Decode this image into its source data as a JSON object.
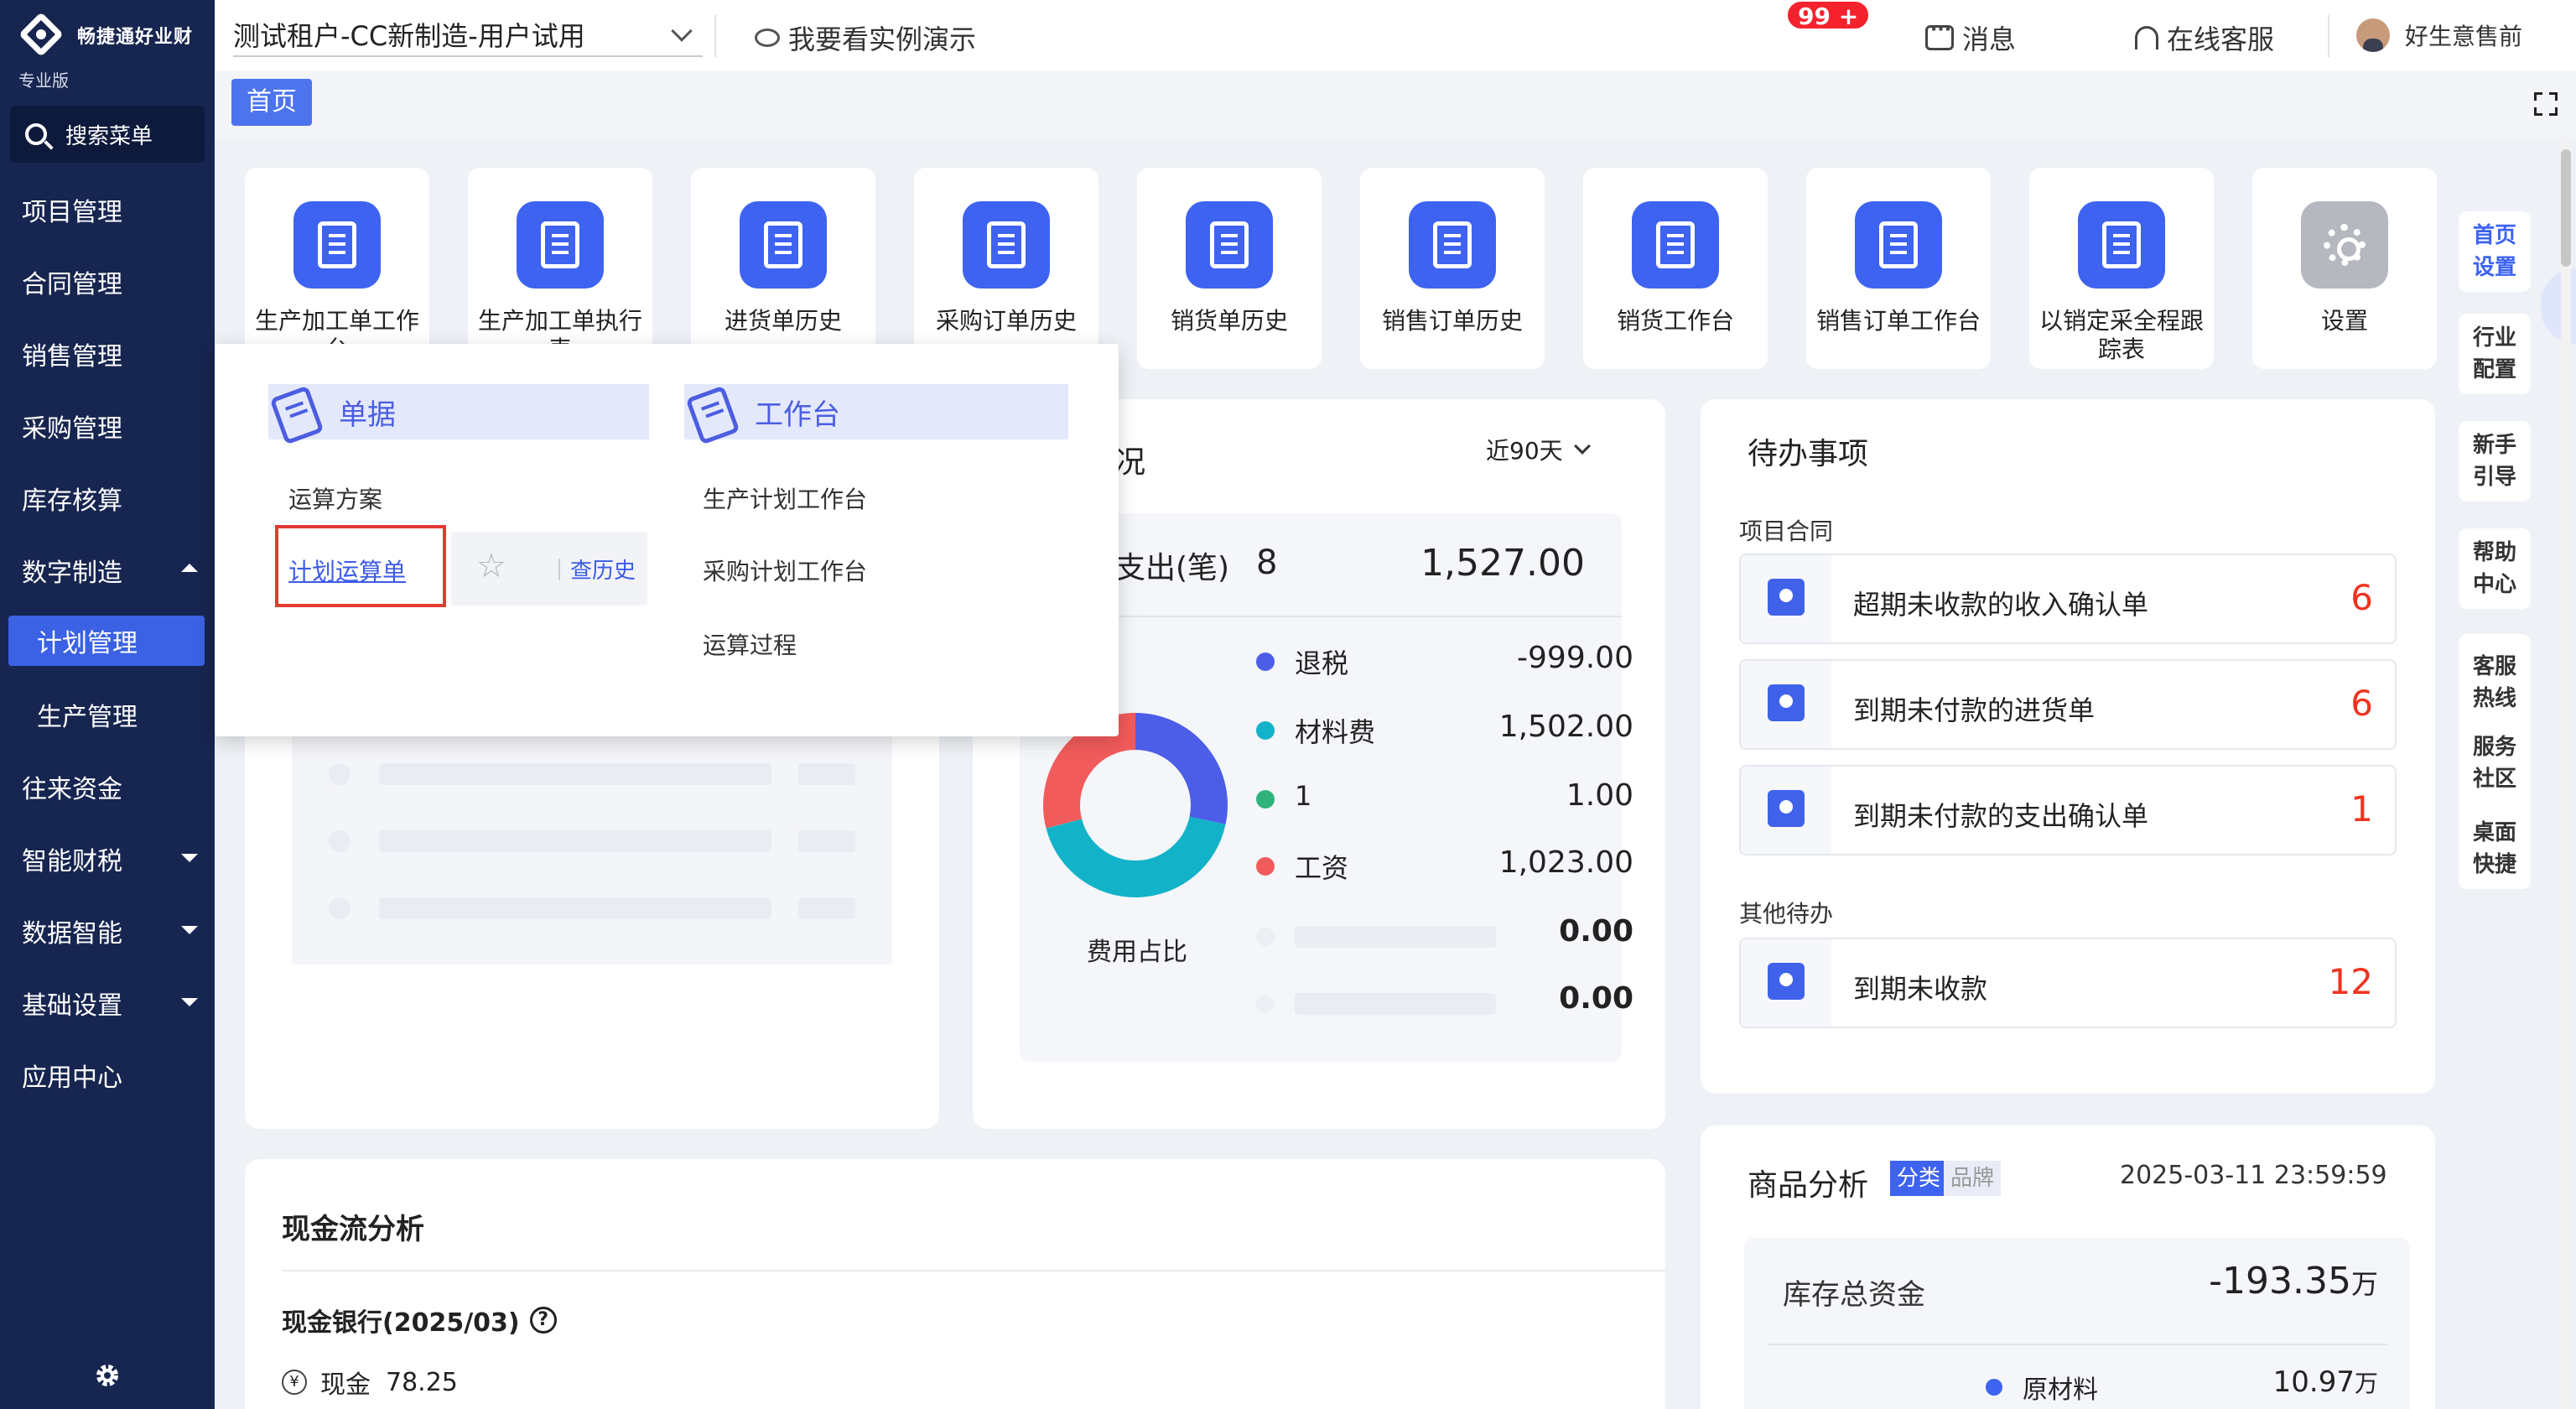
{
  "sidebar": {
    "logo_text": "畅捷通好业财",
    "edition": "专业版",
    "search_label": "搜索菜单",
    "items": [
      {
        "label": "项目管理"
      },
      {
        "label": "合同管理"
      },
      {
        "label": "销售管理"
      },
      {
        "label": "采购管理"
      },
      {
        "label": "库存核算"
      },
      {
        "label": "数字制造"
      },
      {
        "label": "计划管理"
      },
      {
        "label": "生产管理"
      },
      {
        "label": "往来资金"
      },
      {
        "label": "智能财税"
      },
      {
        "label": "数据智能"
      },
      {
        "label": "基础设置"
      },
      {
        "label": "应用中心"
      }
    ]
  },
  "header": {
    "tenant": "测试租户-CC新制造-用户试用",
    "demo": "我要看实例演示",
    "messages": "消息",
    "badge": "99 +",
    "service": "在线客服",
    "user": "好生意售前"
  },
  "tabs": {
    "home": "首页"
  },
  "shortcuts": [
    {
      "label": "生产加工单工作台"
    },
    {
      "label": "生产加工单执行表"
    },
    {
      "label": "进货单历史"
    },
    {
      "label": "采购订单历史"
    },
    {
      "label": "销货单历史"
    },
    {
      "label": "销售订单历史"
    },
    {
      "label": "销货工作台"
    },
    {
      "label": "销售订单工作台"
    },
    {
      "label": "以销定采全程跟踪表"
    },
    {
      "label": "设置"
    }
  ],
  "popup": {
    "col1_title": "单据",
    "col2_title": "工作台",
    "col1_items": [
      "运算方案",
      "计划运算单"
    ],
    "history": "查历史",
    "col2_items": [
      "生产计划工作台",
      "采购计划工作台",
      "运算过程"
    ]
  },
  "expense": {
    "title_fragment": "况",
    "range": "近90天",
    "summary_label": "支出(笔)",
    "summary_count": "8",
    "summary_total": "1,527.00",
    "donut_label": "费用占比",
    "legend": [
      {
        "name": "退税",
        "value": "-999.00",
        "color": "#4c5ee8"
      },
      {
        "name": "材料费",
        "value": "1,502.00",
        "color": "#12b3c8"
      },
      {
        "name": "1",
        "value": "1.00",
        "color": "#2fb37a"
      },
      {
        "name": "工资",
        "value": "1,023.00",
        "color": "#f25b5b"
      },
      {
        "name": "",
        "value": "0.00",
        "color": "#e9ebf2"
      },
      {
        "name": "",
        "value": "0.00",
        "color": "#e9ebf2"
      }
    ]
  },
  "chart_data": {
    "type": "pie",
    "categories": [
      "退税",
      "材料费",
      "1",
      "工资"
    ],
    "values": [
      999,
      1502,
      1,
      1023
    ],
    "title": "费用占比"
  },
  "todo": {
    "title": "待办事项",
    "group1": "项目合同",
    "items1": [
      {
        "label": "超期未收款的收入确认单",
        "count": "6"
      },
      {
        "label": "到期未付款的进货单",
        "count": "6"
      },
      {
        "label": "到期未付款的支出确认单",
        "count": "1"
      }
    ],
    "group2": "其他待办",
    "items2": [
      {
        "label": "到期未收款",
        "count": "12"
      }
    ]
  },
  "cashflow": {
    "title": "现金流分析",
    "subtitle": "现金银行(2025/03)",
    "cash_label": "现金",
    "cash_value": "78.25"
  },
  "product": {
    "title": "商品分析",
    "tab_active": "分类",
    "tab_other": "品牌",
    "datetime": "2025-03-11 23:59:59",
    "inventory_label": "库存总资金",
    "inventory_value": "-193.35",
    "unit": "万",
    "raw_label": "原材料",
    "raw_value": "10.97",
    "raw_unit": "万"
  },
  "rail": [
    {
      "label": "首页设置"
    },
    {
      "label": "行业配置"
    },
    {
      "label": "新手引导"
    },
    {
      "label": "帮助中心"
    },
    {
      "label": "客服热线"
    },
    {
      "label": "服务社区"
    },
    {
      "label": "桌面快捷"
    }
  ],
  "colors": {
    "sidebar": "#172650",
    "accent": "#3d63f0",
    "badge": "#f5222d",
    "count": "#f0331f"
  }
}
